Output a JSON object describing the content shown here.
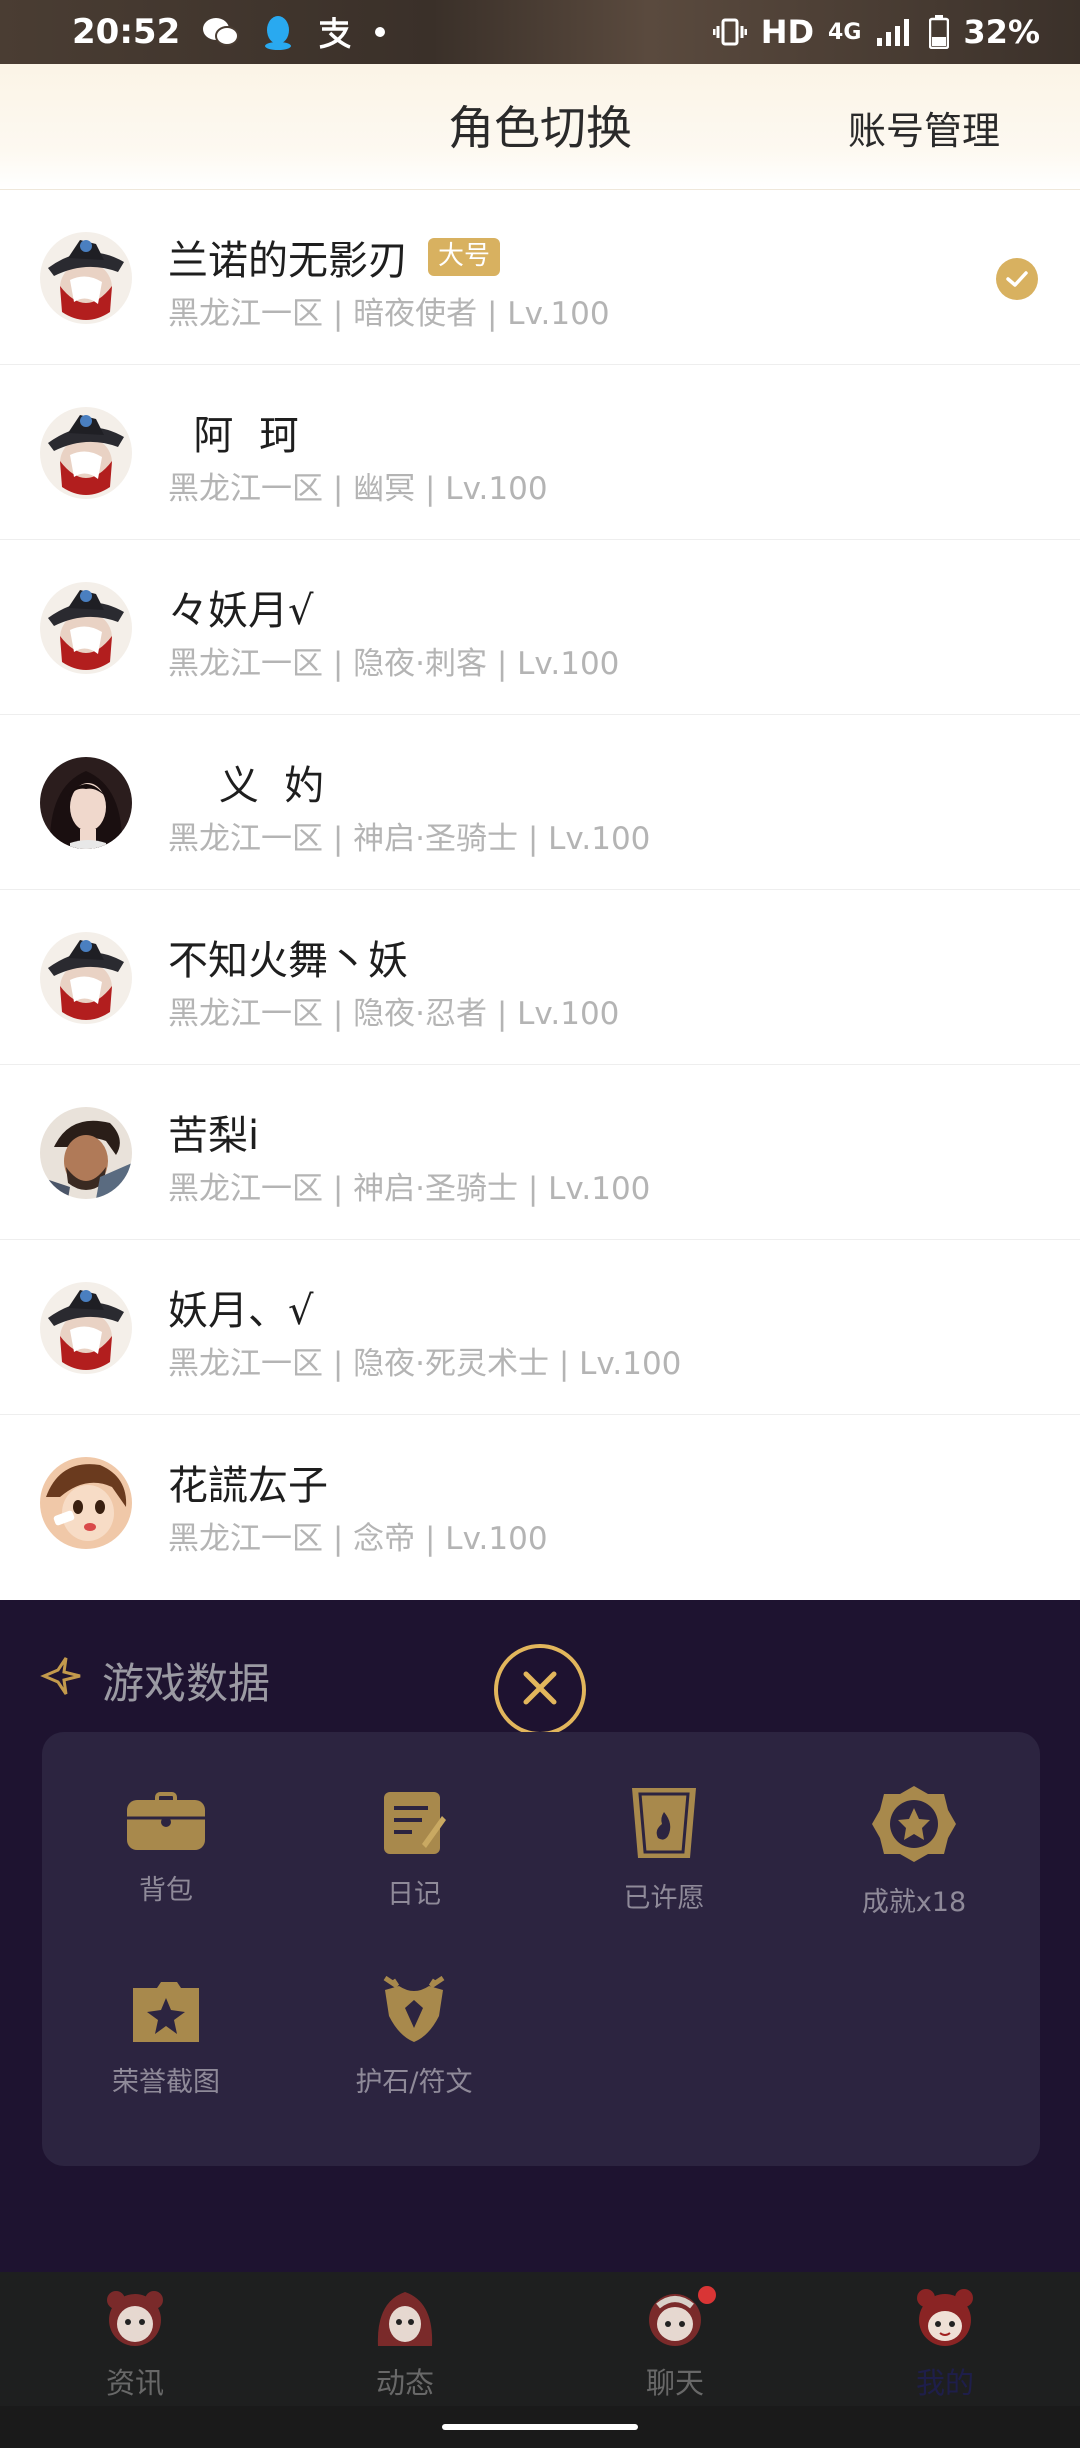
{
  "status_bar": {
    "time": "20:52",
    "hd": "HD",
    "network": "4G",
    "battery": "32%"
  },
  "header": {
    "title": "角色切换",
    "account_manage": "账号管理"
  },
  "roles": [
    {
      "name": "兰诺的无影刃",
      "badge": "大号",
      "info": "黑龙江一区 | 暗夜使者 | Lv.100",
      "selected": true,
      "avatar": "white-hair-hat-avatar"
    },
    {
      "name": "  阿  珂",
      "info": "黑龙江一区 | 幽冥 | Lv.100",
      "avatar": "white-hair-hat-avatar"
    },
    {
      "name": "々妖月√",
      "info": "黑龙江一区 | 隐夜·刺客 | Lv.100",
      "avatar": "white-hair-hat-avatar"
    },
    {
      "name": "    义  妁",
      "info": "黑龙江一区 | 神启·圣骑士 | Lv.100",
      "avatar": "dark-hair-woman-avatar"
    },
    {
      "name": "不知火舞丶妖",
      "info": "黑龙江一区 | 隐夜·忍者 | Lv.100",
      "avatar": "white-hair-hat-avatar"
    },
    {
      "name": "苦梨i",
      "info": "黑龙江一区 | 神启·圣骑士 | Lv.100",
      "avatar": "bearded-warrior-avatar"
    },
    {
      "name": "妖月、√",
      "info": "黑龙江一区 | 隐夜·死灵术士 | Lv.100",
      "avatar": "white-hair-hat-avatar"
    },
    {
      "name": "花謊厷子",
      "info": "黑龙江一区 | 念帝 | Lv.100",
      "avatar": "cartoon-girl-avatar"
    }
  ],
  "game_data": {
    "title": "游戏数据",
    "items": [
      {
        "label": "背包",
        "icon": "bag-icon"
      },
      {
        "label": "日记",
        "icon": "diary-icon"
      },
      {
        "label": "已许愿",
        "icon": "wish-card-icon"
      },
      {
        "label": "成就x18",
        "icon": "achievement-star-icon"
      },
      {
        "label": "荣誉截图",
        "icon": "honor-screenshot-icon"
      },
      {
        "label": "护石/符文",
        "icon": "amulet-rune-icon"
      }
    ]
  },
  "bottom_nav": [
    {
      "label": "资讯",
      "active": false
    },
    {
      "label": "动态",
      "active": false
    },
    {
      "label": "聊天",
      "active": false,
      "badge": true
    },
    {
      "label": "我的",
      "active": true
    }
  ],
  "colors": {
    "accent_gold": "#d8b160",
    "panel_bg": "#1e1330",
    "card_bg": "#2c2440"
  }
}
